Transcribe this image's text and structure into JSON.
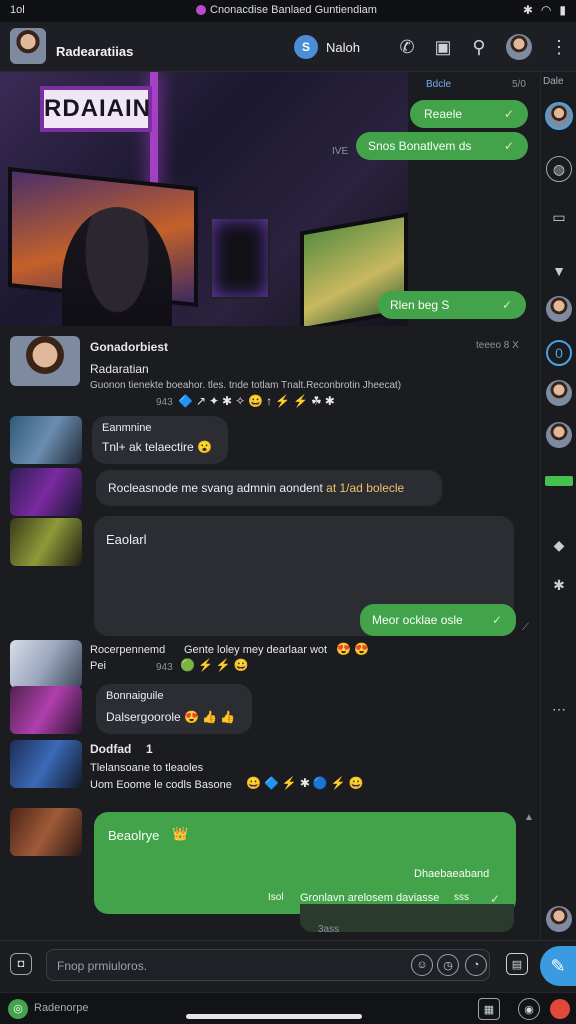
{
  "status_bar": {
    "time": "1ol",
    "center_text": "Cnonacdise Banlaed Guntiendiam",
    "right_icons": [
      "bluetooth-icon",
      "wifi-icon",
      "battery-icon"
    ]
  },
  "header": {
    "title": "",
    "subtitle": "Radearatiias",
    "pill_initial": "S",
    "pill_label": "Naloh",
    "icons": [
      "phone-icon",
      "gift-icon",
      "search-icon",
      "profile-avatar",
      "more-icon"
    ]
  },
  "rail": {
    "top_label": "Dale"
  },
  "hero_sign": "RDAIAIN",
  "messages": {
    "out1_label": "Bdcle",
    "out1_time": "5/0",
    "out1": "Reaele",
    "out2_prefix": "IVE",
    "out2": "Snos Bonatlvem ds",
    "out3": "Rlen beg S",
    "chat1_title": "Gonadorbiest",
    "chat1_time": "teeeo 8 X",
    "chat1_sub": "Radaratian",
    "chat1_line": "Guonon tienekte boeahor. tles. tnde totlam Tnalt.Reconbrotin Jheecat)",
    "chat1_count": "943",
    "chat1_emojis": "🔷↗✦✱✧😀↑⚡⚡☘✱",
    "chat2_name": "Eanmnine",
    "chat2_text": "Tnl+ ak telaectire",
    "chat2_emoji": "😮",
    "chat3_text": "Rocleasnode me svang admnin aondent",
    "chat3_bold": "at 1/ad bolecle",
    "chat4_title": "Eaolarl",
    "chat4_reply": "Meor ocklae osle",
    "chat5_title": "Rocerpennemd",
    "chat5_line": "Gente loley mey dearlaar wot",
    "chat5_sub": "Pei",
    "chat5_count": "943",
    "chat5_emojis": "🟢⚡⚡😀",
    "chat5_end_emojis": "😍😍",
    "chat6_name": "Bonnaiguile",
    "chat6_text": "Dalsergoorole",
    "chat6_emojis": "😍👍👍",
    "chat7_title": "Dodfad",
    "chat7_mark": "1",
    "chat7_line1": "Tlelansoane to tleaoles",
    "chat7_line2": "Uom Eoome le codls Basone",
    "chat7_emojis": "😀🔷⚡✱🔵⚡😀",
    "big_title": "Beaolrye",
    "big_emoji": "👑",
    "big_right": "Dhaebaeaband",
    "big_time": "Isol",
    "big_caption": "Gronlavn arelosem daviasse",
    "big_end": "sss",
    "big_meta": "3ass"
  },
  "composer": {
    "placeholder": "Fnop prmiuloros.",
    "icons": [
      "attach-icon",
      "emoji-icon",
      "clock-icon",
      "timer-icon",
      "sticker-icon",
      "send-icon"
    ]
  },
  "bottom_bar": {
    "label": "Radenorpe"
  },
  "colors": {
    "bubble_green": "#43a34b",
    "bubble_dark": "#2b2d33",
    "accent_blue": "#3b9be0",
    "background": "#1b1c20"
  }
}
